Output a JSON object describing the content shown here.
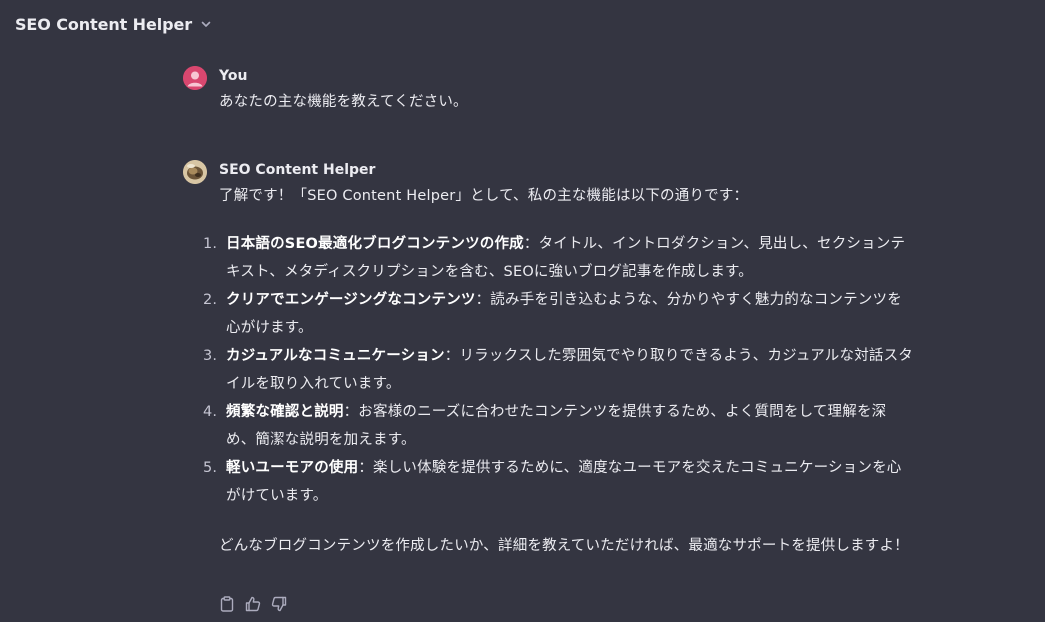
{
  "header": {
    "title": "SEO Content Helper"
  },
  "conversation": [
    {
      "author": "You",
      "text": "あなたの主な機能を教えてください。"
    },
    {
      "author": "SEO Content Helper",
      "intro": "了解です！「SEO Content Helper」として、私の主な機能は以下の通りです：",
      "features": [
        {
          "number": "1.",
          "title": "日本語のSEO最適化ブログコンテンツの作成",
          "description": "：タイトル、イントロダクション、見出し、セクションテキスト、メタディスクリプションを含む、SEOに強いブログ記事を作成します。"
        },
        {
          "number": "2.",
          "title": "クリアでエンゲージングなコンテンツ",
          "description": "：読み手を引き込むような、分かりやすく魅力的なコンテンツを心がけます。"
        },
        {
          "number": "3.",
          "title": "カジュアルなコミュニケーション",
          "description": "：リラックスした雰囲気でやり取りできるよう、カジュアルな対話スタイルを取り入れています。"
        },
        {
          "number": "4.",
          "title": "頻繁な確認と説明",
          "description": "：お客様のニーズに合わせたコンテンツを提供するため、よく質問をして理解を深め、簡潔な説明を加えます。"
        },
        {
          "number": "5.",
          "title": "軽いユーモアの使用",
          "description": "：楽しい体験を提供するために、適度なユーモアを交えたコミュニケーションを心がけています。"
        }
      ],
      "closing": "どんなブログコンテンツを作成したいか、詳細を教えていただければ、最適なサポートを提供しますよ！"
    }
  ],
  "actions": [
    {
      "icon": "clipboard-icon"
    },
    {
      "icon": "thumbs-up-icon"
    },
    {
      "icon": "thumbs-down-icon"
    }
  ],
  "colors": {
    "background": "#343541",
    "text": "#ececf1",
    "user_avatar": "#d9476f",
    "icon": "#acacbe"
  }
}
